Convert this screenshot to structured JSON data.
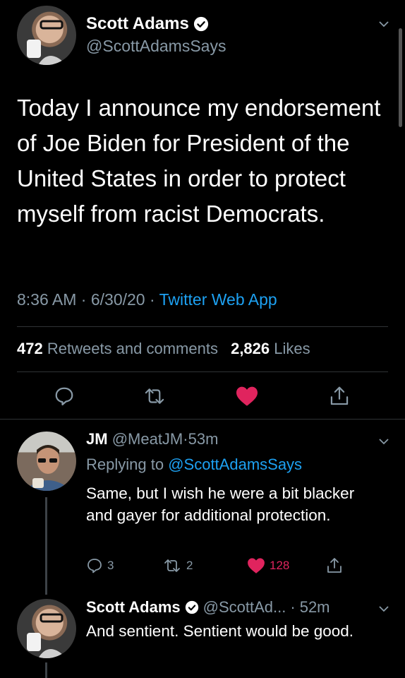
{
  "main_tweet": {
    "author_name": "Scott Adams",
    "handle": "@ScottAdamsSays",
    "text": "Today I announce my endorsement of Joe Biden for President of the United States in order to protect myself from racist Democrats.",
    "time": "8:36 AM",
    "date": "6/30/20",
    "source": "Twitter Web App",
    "retweets_count": "472",
    "retweets_label": "Retweets and comments",
    "likes_count": "2,826",
    "likes_label": "Likes",
    "liked": true
  },
  "reply_1": {
    "author_name": "JM",
    "handle": "@MeatJM",
    "age": "53m",
    "replying_prefix": "Replying to",
    "replying_to": "@ScottAdamsSays",
    "text": "Same, but I wish he were a bit blacker and gayer for additional protection.",
    "reply_count": "3",
    "retweet_count": "2",
    "like_count": "128",
    "liked": true
  },
  "reply_2": {
    "author_name": "Scott Adams",
    "handle": "@ScottAd...",
    "age": "52m",
    "text": "And sentient. Sentient would be good."
  },
  "separator": "·",
  "colors": {
    "background": "#000000",
    "text": "#ffffff",
    "muted": "#8899a6",
    "link": "#1da1f2",
    "like": "#e0245e",
    "divider": "#2f3336"
  }
}
